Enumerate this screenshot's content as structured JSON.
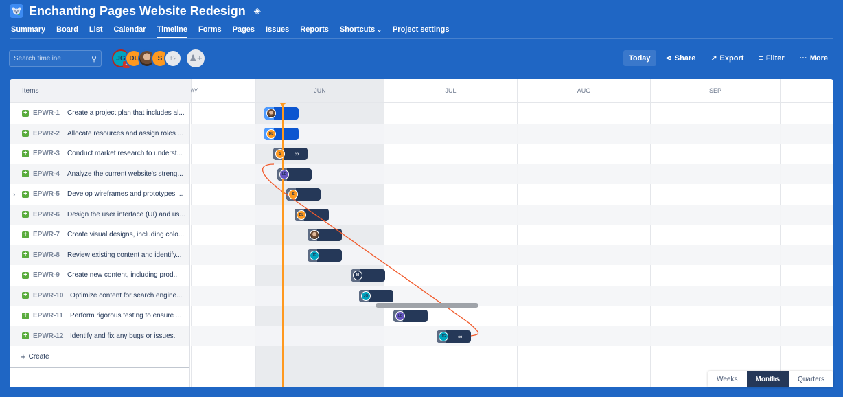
{
  "project": {
    "title": "Enchanting Pages Website Redesign",
    "logo_icon": "koala-icon",
    "customize_icon": "paint-bucket-icon"
  },
  "nav": {
    "items": [
      "Summary",
      "Board",
      "List",
      "Calendar",
      "Timeline",
      "Forms",
      "Pages",
      "Issues",
      "Reports",
      "Shortcuts",
      "Project settings"
    ],
    "active": "Timeline",
    "shortcuts_chevron": "chevron-down-icon"
  },
  "search": {
    "placeholder": "Search timeline",
    "value": ""
  },
  "avatars": {
    "people": [
      {
        "initials": "JG",
        "color": "#00a3bf",
        "badge": "J"
      },
      {
        "initials": "DL",
        "color": "#ff991f"
      },
      {
        "initials": "",
        "color": "photo"
      },
      {
        "initials": "S",
        "color": "#ff991f"
      }
    ],
    "overflow": "+2"
  },
  "toolbar": {
    "today": "Today",
    "share": "Share",
    "export": "Export",
    "filter": "Filter",
    "more": "More"
  },
  "list": {
    "header": "Items",
    "create": "Create",
    "rows": [
      {
        "key": "EPWR-1",
        "summary": "Create a project plan that includes al...",
        "assignee": "photo"
      },
      {
        "key": "EPWR-2",
        "summary": "Allocate resources and assign roles ...",
        "assignee": "DL"
      },
      {
        "key": "EPWR-3",
        "summary": "Conduct market research to underst...",
        "assignee": "S"
      },
      {
        "key": "EPWR-4",
        "summary": "Analyze the current website's streng...",
        "assignee": "LD"
      },
      {
        "key": "EPWR-5",
        "summary": "Develop wireframes and prototypes ...",
        "assignee": "S",
        "expandable": true
      },
      {
        "key": "EPWR-6",
        "summary": "Design the user interface (UI) and us...",
        "assignee": "DL"
      },
      {
        "key": "EPWR-7",
        "summary": "Create visual designs, including colo...",
        "assignee": "photo"
      },
      {
        "key": "EPWR-8",
        "summary": "Review existing content and identify...",
        "assignee": "JG"
      },
      {
        "key": "EPWR-9",
        "summary": "Create new content, including prod...",
        "assignee": "M"
      },
      {
        "key": "EPWR-10",
        "summary": "Optimize content for search engine...",
        "assignee": "JG"
      },
      {
        "key": "EPWR-11",
        "summary": "Perform rigorous testing to ensure ...",
        "assignee": "LD"
      },
      {
        "key": "EPWR-12",
        "summary": "Identify and fix any bugs or issues.",
        "assignee": "JG"
      }
    ]
  },
  "timeline": {
    "months": [
      "AY",
      "JUN",
      "JUL",
      "AUG",
      "SEP"
    ],
    "current_month": "JUN",
    "view_modes": [
      "Weeks",
      "Months",
      "Quarters"
    ],
    "active_view": "Months"
  },
  "colors": {
    "brand": "#1f66c4",
    "bar_dark": "#253858",
    "bar_blue": "#0c56d0",
    "today": "#ff991f",
    "dependency": "#f15a2b",
    "epic": "#5aab3d"
  }
}
